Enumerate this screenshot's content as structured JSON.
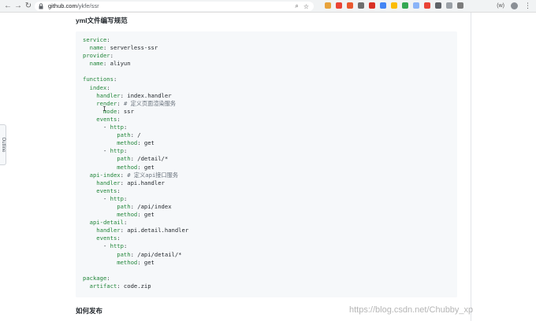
{
  "browser": {
    "back_icon": "←",
    "forward_icon": "→",
    "reload_icon": "↻",
    "url_host": "github.com",
    "url_path": "/ykfe/ssr",
    "zoom_icon": "⌕",
    "star_icon": "☆",
    "extension_colors": [
      "#e8a33c",
      "#ea4335",
      "#e9582f",
      "#6e6e6e",
      "#d93025",
      "#4285f4",
      "#fbbc04",
      "#34a853",
      "#8ab4f8",
      "#e94335",
      "#5f6368",
      "#9aa0a6",
      "#7c7c7c"
    ],
    "ext_label": "(w)",
    "menu_icon": "⋮"
  },
  "sidebar": {
    "outline_label": "Outline"
  },
  "main": {
    "section_title": "yml文件编写规范",
    "next_section_title": "如何发布"
  },
  "code": [
    {
      "key": "service",
      "rest": ":"
    },
    {
      "key": "  name",
      "rest": ": serverless-ssr"
    },
    {
      "key": "provider",
      "rest": ":"
    },
    {
      "key": "  name",
      "rest": ": aliyun"
    },
    {
      "key": "",
      "rest": ""
    },
    {
      "key": "functions",
      "rest": ":"
    },
    {
      "key": "  index",
      "rest": ":"
    },
    {
      "key": "    handler",
      "rest": ": index.handler"
    },
    {
      "key": "    render",
      "rest": ": ",
      "comment": "# 定义页面渲染服务"
    },
    {
      "key": "      mode",
      "rest": ": ssr"
    },
    {
      "key": "    events",
      "rest": ":"
    },
    {
      "key": "",
      "rest": "      - ",
      "key2": "http",
      "rest2": ":"
    },
    {
      "key": "          path",
      "rest": ": /"
    },
    {
      "key": "          method",
      "rest": ": get"
    },
    {
      "key": "",
      "rest": "      - ",
      "key2": "http",
      "rest2": ":"
    },
    {
      "key": "          path",
      "rest": ": /detail/*"
    },
    {
      "key": "          method",
      "rest": ": get"
    },
    {
      "key": "  api-index",
      "rest": ": ",
      "comment": "# 定义api接口服务"
    },
    {
      "key": "    handler",
      "rest": ": api.handler"
    },
    {
      "key": "    events",
      "rest": ":"
    },
    {
      "key": "",
      "rest": "      - ",
      "key2": "http",
      "rest2": ":"
    },
    {
      "key": "          path",
      "rest": ": /api/index"
    },
    {
      "key": "          method",
      "rest": ": get"
    },
    {
      "key": "  api-detail",
      "rest": ":"
    },
    {
      "key": "    handler",
      "rest": ": api.detail.handler"
    },
    {
      "key": "    events",
      "rest": ":"
    },
    {
      "key": "",
      "rest": "      - ",
      "key2": "http",
      "rest2": ":"
    },
    {
      "key": "          path",
      "rest": ": /api/detail/*"
    },
    {
      "key": "          method",
      "rest": ": get"
    },
    {
      "key": "",
      "rest": ""
    },
    {
      "key": "package",
      "rest": ":"
    },
    {
      "key": "  artifact",
      "rest": ": code.zip"
    }
  ],
  "watermark": "https://blog.csdn.net/Chubby_xp"
}
